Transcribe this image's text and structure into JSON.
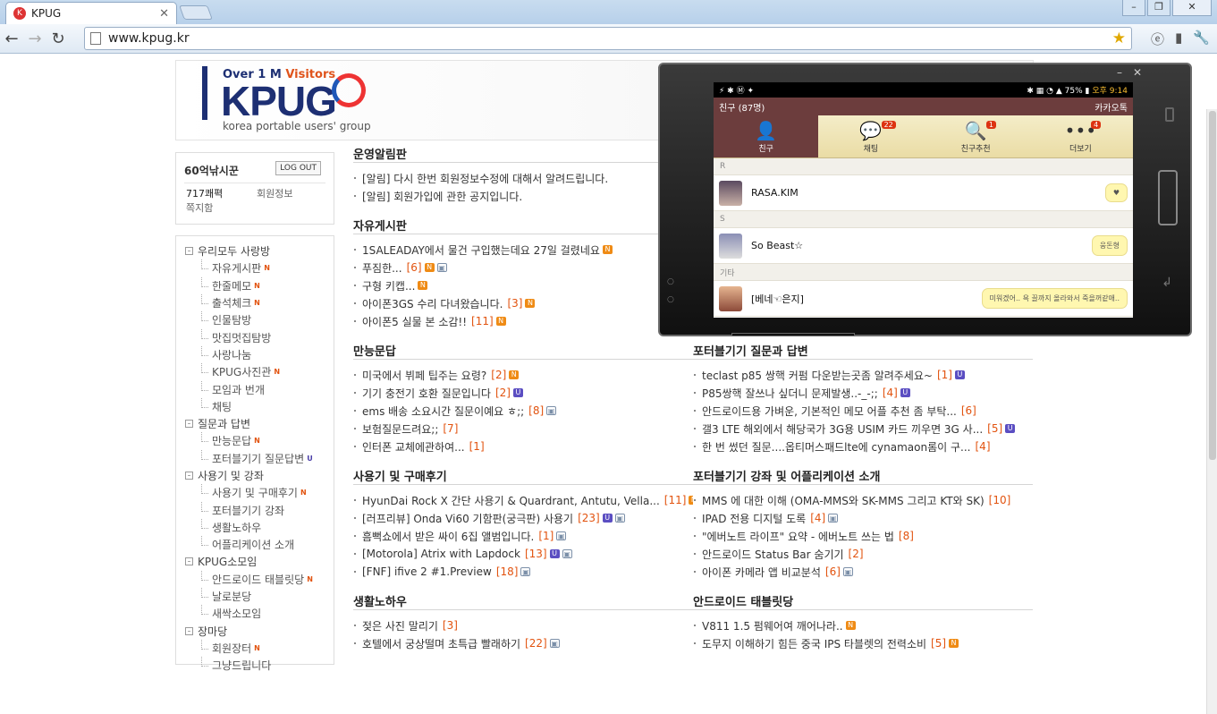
{
  "browser": {
    "tab_title": "KPUG",
    "tab_favicon": "K",
    "url": "www.kpug.kr"
  },
  "header": {
    "visitors_prefix": "Over 1 M",
    "visitors_suffix": "Visitors",
    "logo": "KPUG",
    "subtitle": "korea portable users' group"
  },
  "login": {
    "user": "60억낚시꾼",
    "logout_label": "LOG OUT",
    "points": "717쾌펵",
    "member_info": "회원정보",
    "messages": "쪽지함"
  },
  "menu": [
    {
      "type": "group",
      "label": "우리모두 사랑방",
      "badge": ""
    },
    {
      "type": "sub",
      "label": "자유게시판",
      "badge": "N"
    },
    {
      "type": "sub",
      "label": "한줄메모",
      "badge": "N"
    },
    {
      "type": "sub",
      "label": "출석체크",
      "badge": "N"
    },
    {
      "type": "sub",
      "label": "인물탐방",
      "badge": ""
    },
    {
      "type": "sub",
      "label": "맛집멋집탐방",
      "badge": ""
    },
    {
      "type": "sub",
      "label": "사랑나눔",
      "badge": ""
    },
    {
      "type": "sub",
      "label": "KPUG사진관",
      "badge": "N"
    },
    {
      "type": "sub",
      "label": "모임과 번개",
      "badge": ""
    },
    {
      "type": "sub",
      "label": "채팅",
      "badge": ""
    },
    {
      "type": "group",
      "label": "질문과 답변",
      "badge": ""
    },
    {
      "type": "sub",
      "label": "만능문답",
      "badge": "N"
    },
    {
      "type": "sub",
      "label": "포터블기기 질문답변",
      "badge": "U"
    },
    {
      "type": "group",
      "label": "사용기 및 강좌",
      "badge": ""
    },
    {
      "type": "sub",
      "label": "사용기 및 구매후기",
      "badge": "N"
    },
    {
      "type": "sub",
      "label": "포터블기기 강좌",
      "badge": ""
    },
    {
      "type": "sub",
      "label": "생활노하우",
      "badge": ""
    },
    {
      "type": "sub",
      "label": "어플리케이션 소개",
      "badge": ""
    },
    {
      "type": "group",
      "label": "KPUG소모임",
      "badge": ""
    },
    {
      "type": "sub",
      "label": "안드로이드 태블릿당",
      "badge": "N"
    },
    {
      "type": "sub",
      "label": "날로분당",
      "badge": ""
    },
    {
      "type": "sub",
      "label": "새싹소모임",
      "badge": ""
    },
    {
      "type": "group",
      "label": "장마당",
      "badge": ""
    },
    {
      "type": "sub",
      "label": "회원장터",
      "badge": "N"
    },
    {
      "type": "sub",
      "label": "그냥드립니다",
      "badge": ""
    }
  ],
  "sections": [
    {
      "title": "운영알림판",
      "items": [
        {
          "text": "[알림] 다시 한번 회원정보수정에 대해서 알려드립니다.",
          "count": "",
          "icons": []
        },
        {
          "text": "[알림] 회원가입에 관한 공지입니다.",
          "count": "",
          "icons": []
        }
      ]
    },
    {
      "title": "자유게시판",
      "items": [
        {
          "text": "1SALEADAY에서 물건 구입했는데요 27일 걸렸네요",
          "count": "",
          "icons": [
            "N"
          ]
        },
        {
          "text": "푸짐한...",
          "count": "[6]",
          "icons": [
            "N",
            "P"
          ]
        },
        {
          "text": "구형 키캡...",
          "count": "",
          "icons": [
            "N"
          ]
        },
        {
          "text": "아이폰3GS 수리 다녀왔습니다.",
          "count": "[3]",
          "icons": [
            "N"
          ]
        },
        {
          "text": "아이폰5 실물 본 소감!!",
          "count": "[11]",
          "icons": [
            "N"
          ]
        }
      ]
    },
    {
      "title": "만능문답",
      "items": [
        {
          "text": "미국에서 뷔페 팁주는 요령?",
          "count": "[2]",
          "icons": [
            "N"
          ]
        },
        {
          "text": "기기 충전기 호환 질문입니다",
          "count": "[2]",
          "icons": [
            "U"
          ]
        },
        {
          "text": "ems 배송 소요시간 질문이예요 ㅎ;;",
          "count": "[8]",
          "icons": [
            "P"
          ]
        },
        {
          "text": "보험질문드려요;;",
          "count": "[7]",
          "icons": []
        },
        {
          "text": "인터폰 교체에관하여...",
          "count": "[1]",
          "icons": []
        }
      ]
    },
    {
      "title": "포터블기기 질문과 답변",
      "items": [
        {
          "text": "teclast p85 쌍핵 커펌 다운받는곳좀 알려주세요~",
          "count": "[1]",
          "icons": [
            "U"
          ]
        },
        {
          "text": "P85쌍핵 잘쓰나 싶더니 문제발생..-_-;;",
          "count": "[4]",
          "icons": [
            "U"
          ]
        },
        {
          "text": "안드로이드용 가벼운, 기본적인 메모 어플 추천 좀 부탁...",
          "count": "[6]",
          "icons": []
        },
        {
          "text": "갤3 LTE 해외에서 해당국가 3G용 USIM 카드 끼우면 3G 사...",
          "count": "[5]",
          "icons": [
            "U"
          ]
        },
        {
          "text": "한 번 썼던 질문....옵티머스패드lte에 cynamaon롬이 구...",
          "count": "[4]",
          "icons": []
        }
      ]
    },
    {
      "title": "사용기 및 구매후기",
      "items": [
        {
          "text": "HyunDai Rock X 간단 사용기 & Quardrant, Antutu, Vella...",
          "count": "[11]",
          "icons": [
            "N",
            "P"
          ]
        },
        {
          "text": "[러프리뷰] Onda Vi60 기함판(궁극판) 사용기",
          "count": "[23]",
          "icons": [
            "U",
            "P"
          ]
        },
        {
          "text": "흠뻑쇼에서 받은 싸이 6집 앨범입니다.",
          "count": "[1]",
          "icons": [
            "P"
          ]
        },
        {
          "text": "[Motorola] Atrix with Lapdock",
          "count": "[13]",
          "icons": [
            "U",
            "P"
          ]
        },
        {
          "text": "[FNF] ifive 2 #1.Preview",
          "count": "[18]",
          "icons": [
            "P"
          ]
        }
      ]
    },
    {
      "title": "포터블기기 강좌 및 어플리케이션 소개",
      "items": [
        {
          "text": "MMS 에 대한 이해 (OMA-MMS와 SK-MMS 그리고 KT와 SK)",
          "count": "[10]",
          "icons": []
        },
        {
          "text": "IPAD 전용 디지털 도록",
          "count": "[4]",
          "icons": [
            "P"
          ]
        },
        {
          "text": "\"에버노트 라이프\" 요약 - 에버노트 쓰는 법",
          "count": "[8]",
          "icons": []
        },
        {
          "text": "안드로이드 Status Bar 숨기기",
          "count": "[2]",
          "icons": []
        },
        {
          "text": "아이폰 카메라 앱 비교분석",
          "count": "[6]",
          "icons": [
            "P"
          ]
        }
      ]
    },
    {
      "title": "생활노하우",
      "items": [
        {
          "text": "젖은 사진 말리기",
          "count": "[3]",
          "icons": []
        },
        {
          "text": "호텔에서 궁상떨며 초특급 빨래하기",
          "count": "[22]",
          "icons": [
            "P"
          ]
        }
      ]
    },
    {
      "title": "안드로이드 태블릿당",
      "items": [
        {
          "text": "V811 1.5 펌웨어여 깨어나라..",
          "count": "",
          "icons": [
            "N"
          ]
        },
        {
          "text": "도무지 이해하기 힘든 중국 IPS 타블렛의 전력소비",
          "count": "[5]",
          "icons": [
            "N"
          ]
        }
      ]
    }
  ],
  "phone": {
    "battery": "75%",
    "time": "오후 9:14",
    "friends_title": "친구 (87명)",
    "app_name": "카카오톡",
    "tabs": [
      {
        "label": "친구",
        "badge": "",
        "glyph": "👤"
      },
      {
        "label": "채팅",
        "badge": "22",
        "glyph": "💬"
      },
      {
        "label": "친구추천",
        "badge": "1",
        "glyph": "🔍"
      },
      {
        "label": "더보기",
        "badge": "4",
        "glyph": "•••"
      }
    ],
    "rows": [
      {
        "section": "R",
        "name": "RASA.KIM",
        "msg": "♥"
      },
      {
        "section": "S",
        "name": "So Beast☆",
        "msg": "웅돈형"
      },
      {
        "section": "기타",
        "name": "[베네☜은지]",
        "msg": "미워겠어.. 욕 끌까지 올라와서 죽을꺼같애.."
      }
    ]
  },
  "colors": {
    "accent_orange": "#e2530f",
    "new_badge": "#ef8b15",
    "update_badge": "#5b4ec2",
    "kakao_brown": "#6c3d3d",
    "logo_navy": "#1d2f73"
  }
}
